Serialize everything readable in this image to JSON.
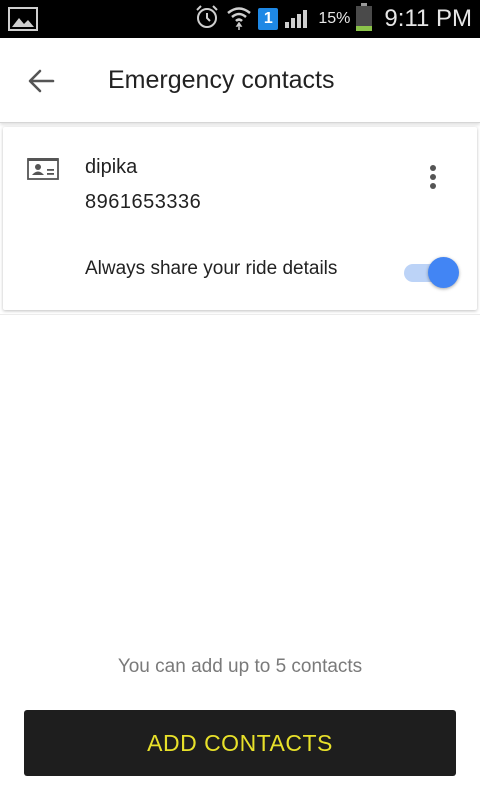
{
  "status_bar": {
    "battery_percent": "15%",
    "time": "9:11 PM",
    "sim_number": "1",
    "icons": [
      "gallery-icon",
      "alarm-icon",
      "wifi-icon",
      "sim-icon",
      "signal-icon",
      "battery-icon"
    ]
  },
  "app_bar": {
    "title": "Emergency contacts",
    "back_icon": "arrow-left-icon"
  },
  "contact": {
    "name": "dipika",
    "phone": "8961653336",
    "share_label": "Always share your ride details",
    "share_enabled": true,
    "icons": [
      "contact-card-icon",
      "more-vertical-icon"
    ]
  },
  "footer": {
    "limit_text": "You can add up to 5 contacts",
    "add_button": "ADD CONTACTS"
  },
  "colors": {
    "accent_blue": "#4285f4",
    "button_bg": "#1e1e1e",
    "button_text": "#e8e12a"
  }
}
